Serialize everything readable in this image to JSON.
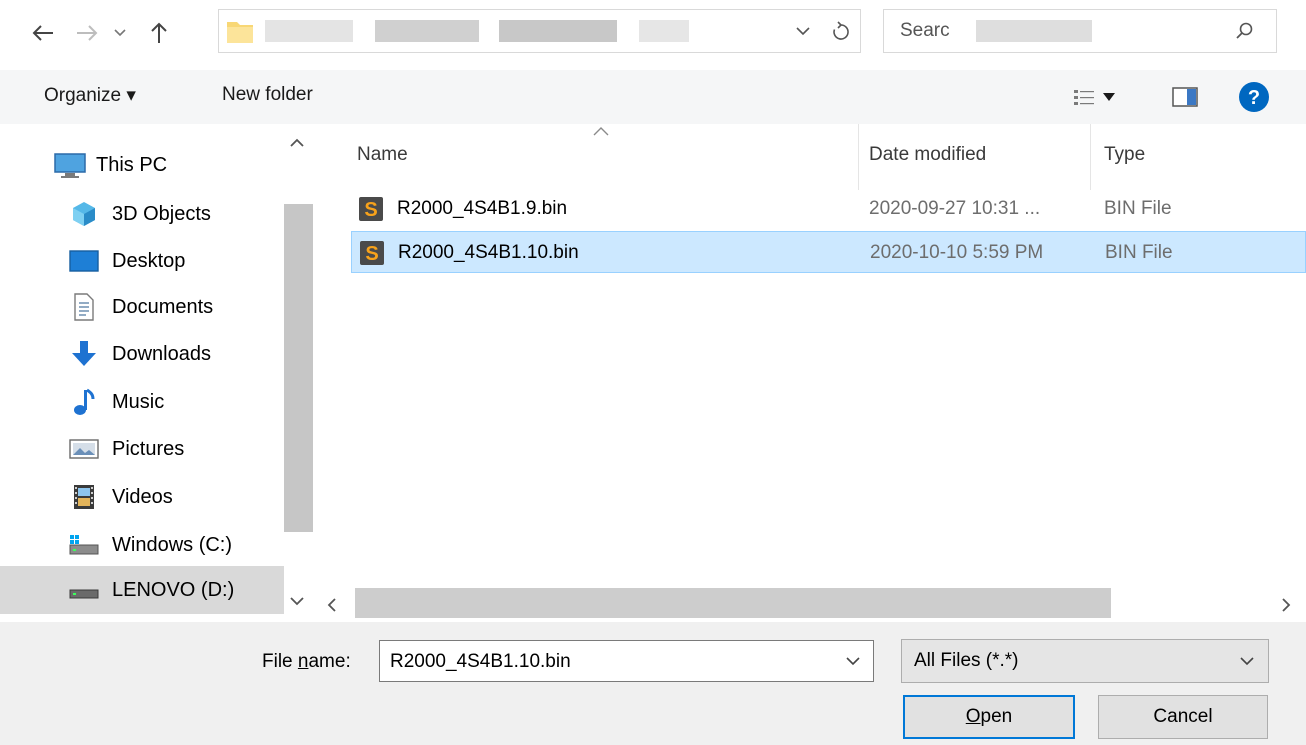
{
  "nav": {
    "address_path": "",
    "search_placeholder": "Searc"
  },
  "toolbar": {
    "organize_label": "Organize ▾",
    "new_folder_label": "New folder"
  },
  "sidebar": {
    "items": [
      {
        "label": "This PC",
        "icon": "this-pc-icon"
      },
      {
        "label": "3D Objects",
        "icon": "3d-objects-icon"
      },
      {
        "label": "Desktop",
        "icon": "desktop-icon"
      },
      {
        "label": "Documents",
        "icon": "documents-icon"
      },
      {
        "label": "Downloads",
        "icon": "downloads-icon"
      },
      {
        "label": "Music",
        "icon": "music-icon"
      },
      {
        "label": "Pictures",
        "icon": "pictures-icon"
      },
      {
        "label": "Videos",
        "icon": "videos-icon"
      },
      {
        "label": "Windows (C:)",
        "icon": "windows-drive-icon"
      },
      {
        "label": "LENOVO (D:)",
        "icon": "drive-icon"
      }
    ],
    "selected": "LENOVO (D:)"
  },
  "filelist": {
    "columns": [
      "Name",
      "Date modified",
      "Type"
    ],
    "rows": [
      {
        "name": "R2000_4S4B1.9.bin",
        "date": "2020-09-27 10:31 ...",
        "type": "BIN File",
        "selected": false
      },
      {
        "name": "R2000_4S4B1.10.bin",
        "date": "2020-10-10 5:59 PM",
        "type": "BIN File",
        "selected": true
      }
    ]
  },
  "bottom": {
    "filename_label_pre": "File ",
    "filename_label_u": "n",
    "filename_label_post": "ame:",
    "filename_value": "R2000_4S4B1.10.bin",
    "filter_value": "All Files (*.*)",
    "open_label_u": "O",
    "open_label_rest": "pen",
    "cancel_label": "Cancel"
  },
  "colors": {
    "selection": "#cce8ff",
    "selection_border": "#99d1ff",
    "help_blue": "#0067c0",
    "bin_icon_orange": "#f7a21b"
  }
}
